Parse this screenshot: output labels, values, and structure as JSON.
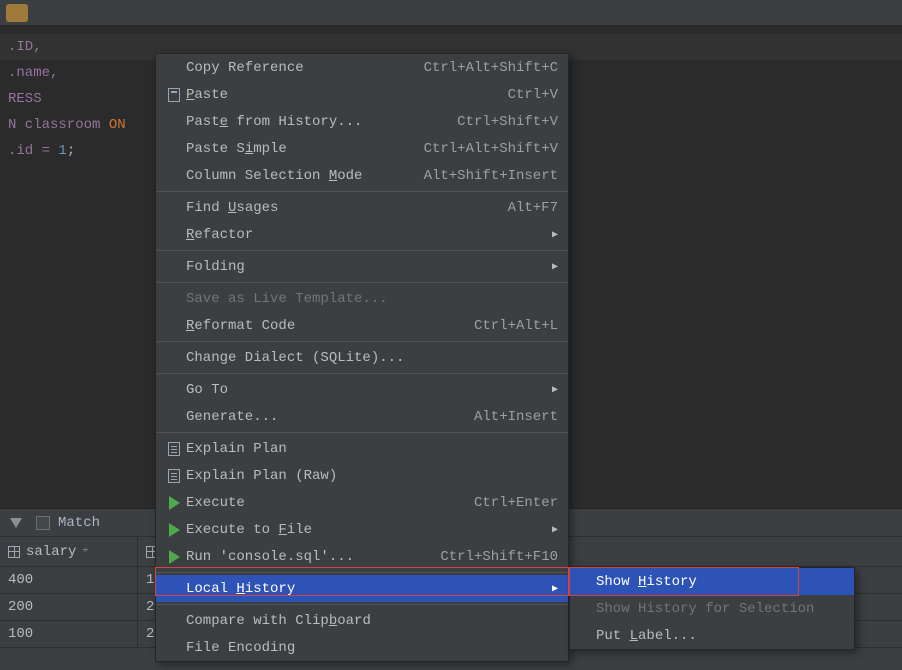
{
  "code": {
    "l1": ".ID,",
    "l2": ".name,",
    "l3": "",
    "l4": "",
    "l5": "RESS",
    "l6a": "N classroom ",
    "l6b": "ON",
    "l7a": ".id = ",
    "l7b": "1",
    "l7c": ";"
  },
  "bottom": {
    "match_label": "Match",
    "col_salary": "salary",
    "rows": [
      "400",
      "200",
      "100"
    ],
    "rows_b": [
      "1",
      "2",
      "2"
    ]
  },
  "menu": {
    "copy_reference": "Copy Reference",
    "copy_reference_sc": "Ctrl+Alt+Shift+C",
    "paste": "Paste",
    "paste_sc": "Ctrl+V",
    "paste_history": "Paste from History...",
    "paste_history_sc": "Ctrl+Shift+V",
    "paste_simple": "Paste Simple",
    "paste_simple_sc": "Ctrl+Alt+Shift+V",
    "col_sel": "Column Selection Mode",
    "col_sel_sc": "Alt+Shift+Insert",
    "find_usages": "Find Usages",
    "find_usages_sc": "Alt+F7",
    "refactor": "Refactor",
    "folding": "Folding",
    "save_live": "Save as Live Template...",
    "reformat": "Reformat Code",
    "reformat_sc": "Ctrl+Alt+L",
    "change_dialect": "Change Dialect (SQLite)...",
    "goto": "Go To",
    "generate": "Generate...",
    "generate_sc": "Alt+Insert",
    "explain_plan": "Explain Plan",
    "explain_plan_raw": "Explain Plan (Raw)",
    "execute": "Execute",
    "execute_sc": "Ctrl+Enter",
    "execute_to_file": "Execute to File",
    "run_console": "Run 'console.sql'...",
    "run_console_sc": "Ctrl+Shift+F10",
    "local_history": "Local History",
    "compare_clip": "Compare with Clipboard",
    "file_encoding": "File Encoding"
  },
  "submenu": {
    "show_history": "Show History",
    "show_history_sel": "Show History for Selection",
    "put_label": "Put Label..."
  }
}
